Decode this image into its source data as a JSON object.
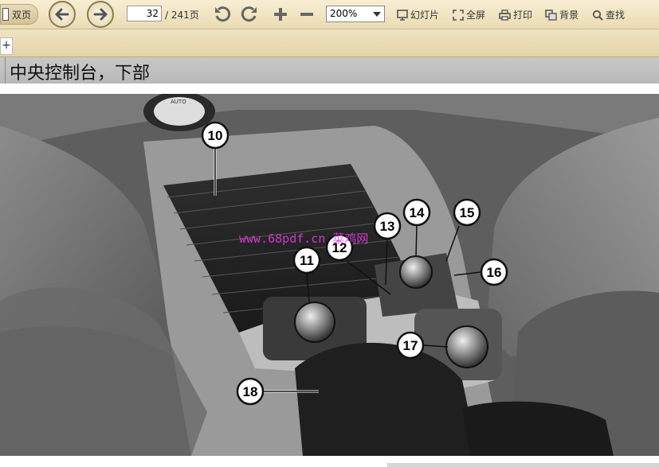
{
  "toolbar": {
    "two_page_label": "双页",
    "page_current": "32",
    "page_total": "/ 241页",
    "zoom_value": "200%",
    "slideshow_label": "幻灯片",
    "fullscreen_label": "全屏",
    "print_label": "打印",
    "background_label": "背景",
    "search_label": "查找",
    "icons": [
      "back-arrow-icon",
      "forward-arrow-icon",
      "rotate-left-icon",
      "rotate-right-icon",
      "zoom-in-icon",
      "zoom-out-icon",
      "slideshow-icon",
      "fullscreen-icon",
      "print-icon",
      "background-icon",
      "search-icon"
    ]
  },
  "tabbar": {
    "add_label": "+"
  },
  "document": {
    "heading": "中央控制台，下部",
    "watermark": "www.68pdf.cn 菜鸡网",
    "callouts": [
      "10",
      "11",
      "12",
      "13",
      "14",
      "15",
      "16",
      "17",
      "18"
    ]
  },
  "colors": {
    "toolbar_bg": "#f0e5c5",
    "heading_bar": "#c0c0c0",
    "watermark": "#e13be0"
  }
}
